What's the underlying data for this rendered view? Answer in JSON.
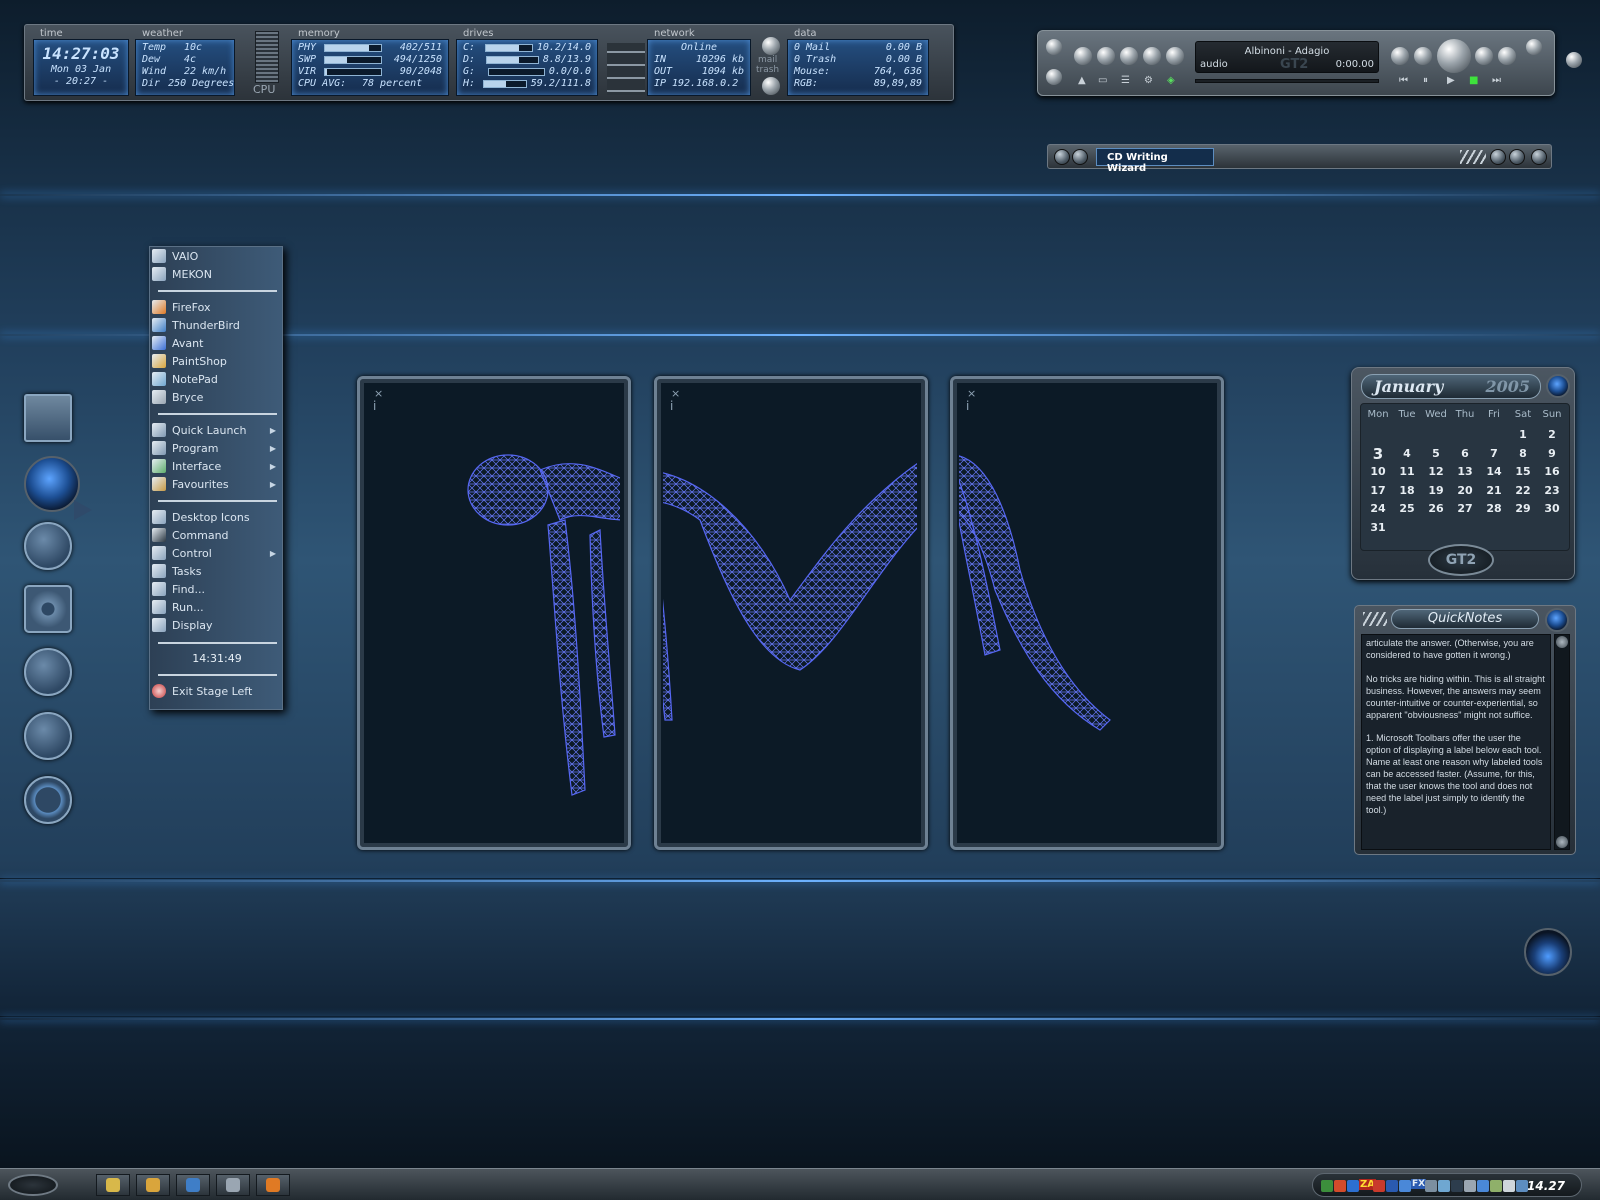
{
  "topbar": {
    "time": {
      "label": "time",
      "clock": "14:27:03",
      "date": "Mon 03 Jan",
      "alt": "- 20:27 -"
    },
    "weather": {
      "label": "weather",
      "rows": [
        [
          "Temp",
          "10c"
        ],
        [
          "Dew",
          "4c"
        ],
        [
          "Wind",
          "22 km/h"
        ],
        [
          "Dir",
          "250 Degrees"
        ]
      ]
    },
    "cpu": {
      "label": "CPU"
    },
    "memory": {
      "label": "memory",
      "rows": [
        {
          "k": "PHY",
          "v": "402/511",
          "fill": 0.79
        },
        {
          "k": "SWP",
          "v": "494/1250",
          "fill": 0.4
        },
        {
          "k": "VIR",
          "v": "90/2048",
          "fill": 0.04
        }
      ],
      "cpu_avg_label": "CPU AVG:",
      "cpu_avg": "78 percent"
    },
    "drives": {
      "label": "drives",
      "rows": [
        {
          "k": "C:",
          "v": "10.2/14.0",
          "fill": 0.73
        },
        {
          "k": "D:",
          "v": "8.8/13.9",
          "fill": 0.63
        },
        {
          "k": "G:",
          "v": "0.0/0.0",
          "fill": 0.0
        },
        {
          "k": "H:",
          "v": "59.2/111.8",
          "fill": 0.53
        }
      ]
    },
    "mail": {
      "label": "mail",
      "trash": "trash"
    },
    "network": {
      "label": "network",
      "status": "Online",
      "in_label": "IN",
      "in": "10296 kb",
      "out_label": "OUT",
      "out": "1094 kb",
      "ip_label": "IP",
      "ip": "192.168.0.2"
    },
    "data": {
      "label": "data",
      "rows": [
        [
          "0 Mail",
          "0.00 B"
        ],
        [
          "0 Trash",
          "0.00 B"
        ],
        [
          "Mouse:",
          "764, 636"
        ],
        [
          "RGB:",
          "89,89,89"
        ]
      ]
    }
  },
  "player": {
    "track": "Albinoni - Adagio",
    "source": "audio",
    "logo": "GT2",
    "time": "0:00.00",
    "controls": {
      "prev": "⏮",
      "pause": "⏸",
      "play": "▶",
      "stop": "■",
      "next": "⏭"
    }
  },
  "cd_wizard": {
    "title": "CD Writing Wizard"
  },
  "start_menu": {
    "groups": [
      [
        {
          "label": "VAIO",
          "icon": "app-icon",
          "color": "#8aa3bd"
        },
        {
          "label": "MEKON",
          "icon": "app-icon",
          "color": "#8aa3bd"
        }
      ],
      [
        {
          "label": "FireFox",
          "icon": "firefox-icon",
          "color": "#e07a24"
        },
        {
          "label": "ThunderBird",
          "icon": "thunderbird-icon",
          "color": "#3f7ec7"
        },
        {
          "label": "Avant",
          "icon": "avant-icon",
          "color": "#3b6fd6"
        },
        {
          "label": "PaintShop",
          "icon": "paintshop-icon",
          "color": "#d9a53c"
        },
        {
          "label": "NotePad",
          "icon": "notepad-icon",
          "color": "#6fa7d1"
        },
        {
          "label": "Bryce",
          "icon": "bryce-icon",
          "color": "#9aa6b2"
        }
      ],
      [
        {
          "label": "Quick Launch",
          "icon": "quicklaunch-icon",
          "color": "#7f98b2",
          "sub": "▶"
        },
        {
          "label": "Program",
          "icon": "program-icon",
          "color": "#7f98b2",
          "sub": "▶"
        },
        {
          "label": "Interface",
          "icon": "interface-icon",
          "color": "#5fae6c",
          "sub": "▶"
        },
        {
          "label": "Favourites",
          "icon": "favourites-icon",
          "color": "#c79a45",
          "sub": "▶"
        }
      ],
      [
        {
          "label": "Desktop Icons",
          "icon": "desktop-icon",
          "color": "#8aa3bd"
        },
        {
          "label": "Command",
          "icon": "command-icon",
          "color": "#2b3742"
        },
        {
          "label": "Control",
          "icon": "control-icon",
          "color": "#8aa3bd",
          "sub": "▶"
        },
        {
          "label": "Tasks",
          "icon": "tasks-icon",
          "color": "#8aa3bd"
        },
        {
          "label": "Find...",
          "icon": "find-icon",
          "color": "#8aa3bd"
        },
        {
          "label": "Run...",
          "icon": "run-icon",
          "color": "#8aa3bd"
        },
        {
          "label": "Display",
          "icon": "display-icon",
          "color": "#8aa3bd"
        }
      ]
    ],
    "clock": "14:31:49",
    "exit": {
      "label": "Exit Stage Left",
      "icon": "exit-icon",
      "color": "#c73a3a"
    }
  },
  "dock": [
    {
      "icon": "monitor-icon"
    },
    {
      "icon": "globe-icon"
    },
    {
      "icon": "mailbox-icon"
    },
    {
      "icon": "gear-icon"
    },
    {
      "icon": "folder-icon"
    },
    {
      "icon": "search-icon"
    },
    {
      "icon": "refresh-icon"
    }
  ],
  "panels": [
    {
      "close": "×",
      "info": "i"
    },
    {
      "close": "×",
      "info": "i"
    },
    {
      "close": "×",
      "info": "i"
    }
  ],
  "calendar": {
    "month": "January",
    "year": "2005",
    "logo": "GT2",
    "weekdays": [
      "Mon",
      "Tue",
      "Wed",
      "Thu",
      "Fri",
      "Sat",
      "Sun"
    ],
    "first_weekday_index": 5,
    "days_in_month": 31,
    "today": 3
  },
  "quicknotes": {
    "title": "QuickNotes",
    "paragraphs": [
      "articulate the answer. (Otherwise, you are considered to have gotten it wrong.)",
      "No tricks are hiding within. This is all straight business. However, the answers may seem counter-intuitive or counter-experiential, so apparent \"obviousness\" might not suffice.",
      "1. Microsoft Toolbars offer the user the option of displaying a label below each tool. Name at least one reason why labeled tools can be accessed faster. (Assume, for this, that the user knows the tool and does not need the label just simply to identify the tool.)"
    ]
  },
  "taskbar": {
    "buttons": [
      {
        "icon": "folder-icon",
        "color": "#d8b84a"
      },
      {
        "icon": "paintshop-icon",
        "color": "#d9a53c"
      },
      {
        "icon": "thunderbird-icon",
        "color": "#3f7ec7"
      },
      {
        "icon": "network-icon",
        "color": "#9aa6b2"
      },
      {
        "icon": "firefox-icon",
        "color": "#e07a24"
      }
    ],
    "tray_icons": [
      "#3c8f3c",
      "#d24b2b",
      "#2c6fd0",
      "#e8d23a",
      "#c93a2c",
      "#2a5ab0",
      "#4a88d8",
      "#d94848",
      "#7c8fa0",
      "#6fa7d1",
      "#2d3d4d",
      "#9aa6b2",
      "#4a88d8",
      "#8fb06a",
      "#cfd6dc",
      "#5d8dc0"
    ],
    "za_label": "ZA",
    "fx_label": "FX",
    "clock": "14.27"
  }
}
